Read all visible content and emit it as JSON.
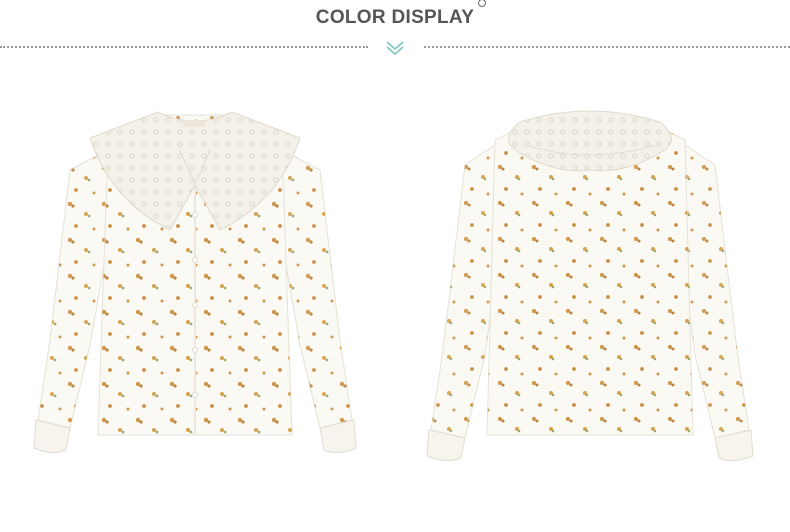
{
  "header": {
    "title": "COLOR DISPLAY"
  },
  "images": {
    "front": {
      "icon": "blouse-front-photo"
    },
    "back": {
      "icon": "blouse-back-photo"
    }
  },
  "colors": {
    "title": "#555555",
    "chevron": "#7fc4c0",
    "fabric": "#fbf9f3",
    "floral": "#c8862a"
  }
}
